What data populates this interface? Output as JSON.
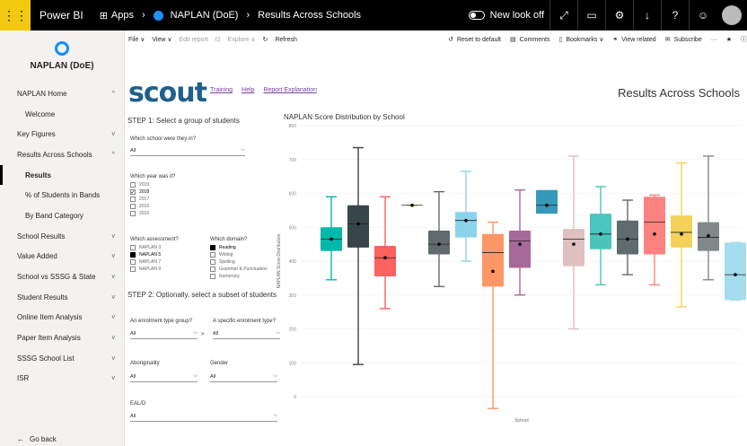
{
  "topbar": {
    "brand": "Power BI",
    "apps": "Apps",
    "report": "NAPLAN (DoE)",
    "page": "Results Across Schools",
    "new_look": "New look off"
  },
  "sidebar": {
    "title": "NAPLAN (DoE)",
    "items": [
      {
        "label": "NAPLAN Home",
        "chevron": "^",
        "level": "top"
      },
      {
        "label": "Welcome",
        "chevron": "",
        "level": "sub"
      },
      {
        "label": "Key Figures",
        "chevron": "v",
        "level": "top"
      },
      {
        "label": "Results Across Schools",
        "chevron": "^",
        "level": "top"
      },
      {
        "label": "Results",
        "chevron": "",
        "level": "active"
      },
      {
        "label": "% of Students in Bands",
        "chevron": "",
        "level": "sub"
      },
      {
        "label": "By Band Category",
        "chevron": "",
        "level": "sub"
      },
      {
        "label": "School Results",
        "chevron": "v",
        "level": "top"
      },
      {
        "label": "Value Added",
        "chevron": "v",
        "level": "top"
      },
      {
        "label": "School vs SSSG & State",
        "chevron": "v",
        "level": "top"
      },
      {
        "label": "Student Results",
        "chevron": "v",
        "level": "top"
      },
      {
        "label": "Online Item Analysis",
        "chevron": "v",
        "level": "top"
      },
      {
        "label": "Paper Item Analysis",
        "chevron": "v",
        "level": "top"
      },
      {
        "label": "SSSG School List",
        "chevron": "v",
        "level": "top"
      },
      {
        "label": "ISR",
        "chevron": "v",
        "level": "top"
      }
    ],
    "go_back": "Go back"
  },
  "toolbar": {
    "file": "File ∨",
    "view": "View ∨",
    "edit": "Edit report",
    "explore": "Explore ∨",
    "refresh": "Refresh",
    "reset": "Reset to default",
    "comments": "Comments",
    "bookmarks": "Bookmarks ∨",
    "view_related": "View related",
    "subscribe": "Subscribe",
    "more": "···"
  },
  "report": {
    "logo": "scout",
    "links": [
      "Training",
      "Help",
      "Report Explanation"
    ],
    "title": "Results Across Schools",
    "step1": "STEP 1: Select a group of students",
    "school_q": "Which school were they in?",
    "school_val": "All",
    "year_q": "Which year was it?",
    "years": [
      {
        "label": "2019",
        "checked": false
      },
      {
        "label": "2018",
        "checked": true
      },
      {
        "label": "2017",
        "checked": false
      },
      {
        "label": "2016",
        "checked": false
      },
      {
        "label": "2015",
        "checked": false
      }
    ],
    "assessment_q": "Which assessment?",
    "assessments": [
      {
        "label": "NAPLAN 3",
        "checked": false
      },
      {
        "label": "NAPLAN 5",
        "checked": true
      },
      {
        "label": "NAPLAN 7",
        "checked": false
      },
      {
        "label": "NAPLAN 9",
        "checked": false
      }
    ],
    "domain_q": "Which domain?",
    "domains": [
      {
        "label": "Reading",
        "checked": true
      },
      {
        "label": "Writing",
        "checked": false
      },
      {
        "label": "Spelling",
        "checked": false
      },
      {
        "label": "Grammar & Punctuation",
        "checked": false
      },
      {
        "label": "Numeracy",
        "checked": false
      }
    ],
    "step2": "STEP 2: Optionally, select a subset of students",
    "enrol_q": "An enrolment type group?",
    "enrol_val": "All",
    "enrol_spec_q": "A specific enrolment type?",
    "enrol_spec_val": "All",
    "gt": ">",
    "aboriginality": "Aboriginality",
    "aboriginality_val": "All",
    "gender": "Gender",
    "gender_val": "All",
    "eald": "EAL/D",
    "eald_val": "All"
  },
  "chart_data": {
    "type": "box",
    "title": "NAPLAN Score Distribution by School",
    "xlabel": "School",
    "ylabel": "NAPLAN Score Distribution",
    "ylim": [
      0,
      800
    ],
    "yticks": [
      0,
      100,
      200,
      300,
      400,
      500,
      600,
      700,
      800
    ],
    "boxes": [
      {
        "color": "#01b8aa",
        "min": 345,
        "q1": 430,
        "median": 465,
        "q3": 500,
        "max": 590,
        "mean": 465
      },
      {
        "color": "#374649",
        "min": 95,
        "q1": 440,
        "median": 510,
        "q3": 565,
        "max": 735,
        "mean": 510
      },
      {
        "color": "#fd625e",
        "min": 260,
        "q1": 355,
        "median": 410,
        "q3": 445,
        "max": 590,
        "mean": 410
      },
      {
        "color": "#f2c80f",
        "min": 565,
        "q1": 565,
        "median": 565,
        "q3": 565,
        "max": 565,
        "mean": 565
      },
      {
        "color": "#5f6b6d",
        "min": 325,
        "q1": 420,
        "median": 450,
        "q3": 490,
        "max": 605,
        "mean": 450
      },
      {
        "color": "#8ad4eb",
        "min": 400,
        "q1": 470,
        "median": 520,
        "q3": 545,
        "max": 665,
        "mean": 520
      },
      {
        "color": "#fe9666",
        "min": -35,
        "q1": 325,
        "median": 425,
        "q3": 480,
        "max": 515,
        "mean": 370
      },
      {
        "color": "#a66999",
        "min": 300,
        "q1": 380,
        "median": 460,
        "q3": 490,
        "max": 610,
        "mean": 450
      },
      {
        "color": "#3599b8",
        "min": 565,
        "q1": 540,
        "median": 565,
        "q3": 610,
        "max": 565,
        "mean": 565
      },
      {
        "color": "#dfbfbf",
        "min": 200,
        "q1": 385,
        "median": 465,
        "q3": 495,
        "max": 710,
        "mean": 450
      },
      {
        "color": "#4ac5bb",
        "min": 330,
        "q1": 435,
        "median": 480,
        "q3": 540,
        "max": 620,
        "mean": 480
      },
      {
        "color": "#5f6b6d",
        "min": 360,
        "q1": 420,
        "median": 465,
        "q3": 520,
        "max": 580,
        "mean": 465
      },
      {
        "color": "#fb8281",
        "min": 330,
        "q1": 420,
        "median": 515,
        "q3": 590,
        "max": 595,
        "mean": 480
      },
      {
        "color": "#f4d25a",
        "min": 265,
        "q1": 440,
        "median": 485,
        "q3": 535,
        "max": 690,
        "mean": 480
      },
      {
        "color": "#7f898a",
        "min": 345,
        "q1": 430,
        "median": 470,
        "q3": 515,
        "max": 710,
        "mean": 475
      },
      {
        "color": "#a4ddee",
        "min": 285,
        "q1": 285,
        "median": 360,
        "q3": 455,
        "max": 455,
        "mean": 360
      }
    ]
  }
}
